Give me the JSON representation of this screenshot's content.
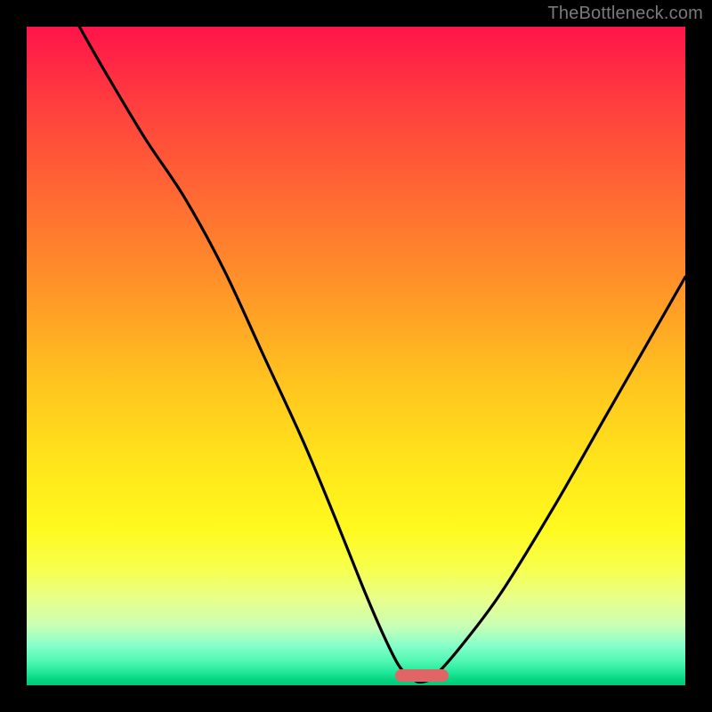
{
  "watermark": "TheBottleneck.com",
  "colors": {
    "frame": "#000000",
    "marker": "#e06666",
    "curve": "#000000"
  },
  "marker": {
    "x_frac": 0.56,
    "width_frac": 0.08,
    "y_frac": 0.985
  },
  "chart_data": {
    "type": "line",
    "title": "",
    "xlabel": "",
    "ylabel": "",
    "xlim": [
      0,
      100
    ],
    "ylim": [
      0,
      100
    ],
    "series": [
      {
        "name": "bottleneck-curve",
        "x": [
          8,
          12,
          18,
          24,
          30,
          36,
          42,
          47,
          51,
          54,
          56.5,
          58.5,
          60,
          62,
          66,
          72,
          80,
          88,
          96,
          100
        ],
        "y": [
          100,
          93,
          83,
          74,
          63,
          50,
          37,
          25,
          15,
          8,
          3,
          1,
          0.5,
          1.5,
          6,
          14,
          27,
          41,
          55,
          62
        ]
      }
    ],
    "annotations": [
      {
        "type": "marker-pill",
        "x_center_frac": 0.6,
        "width_frac": 0.08,
        "color": "#e06666"
      }
    ]
  }
}
